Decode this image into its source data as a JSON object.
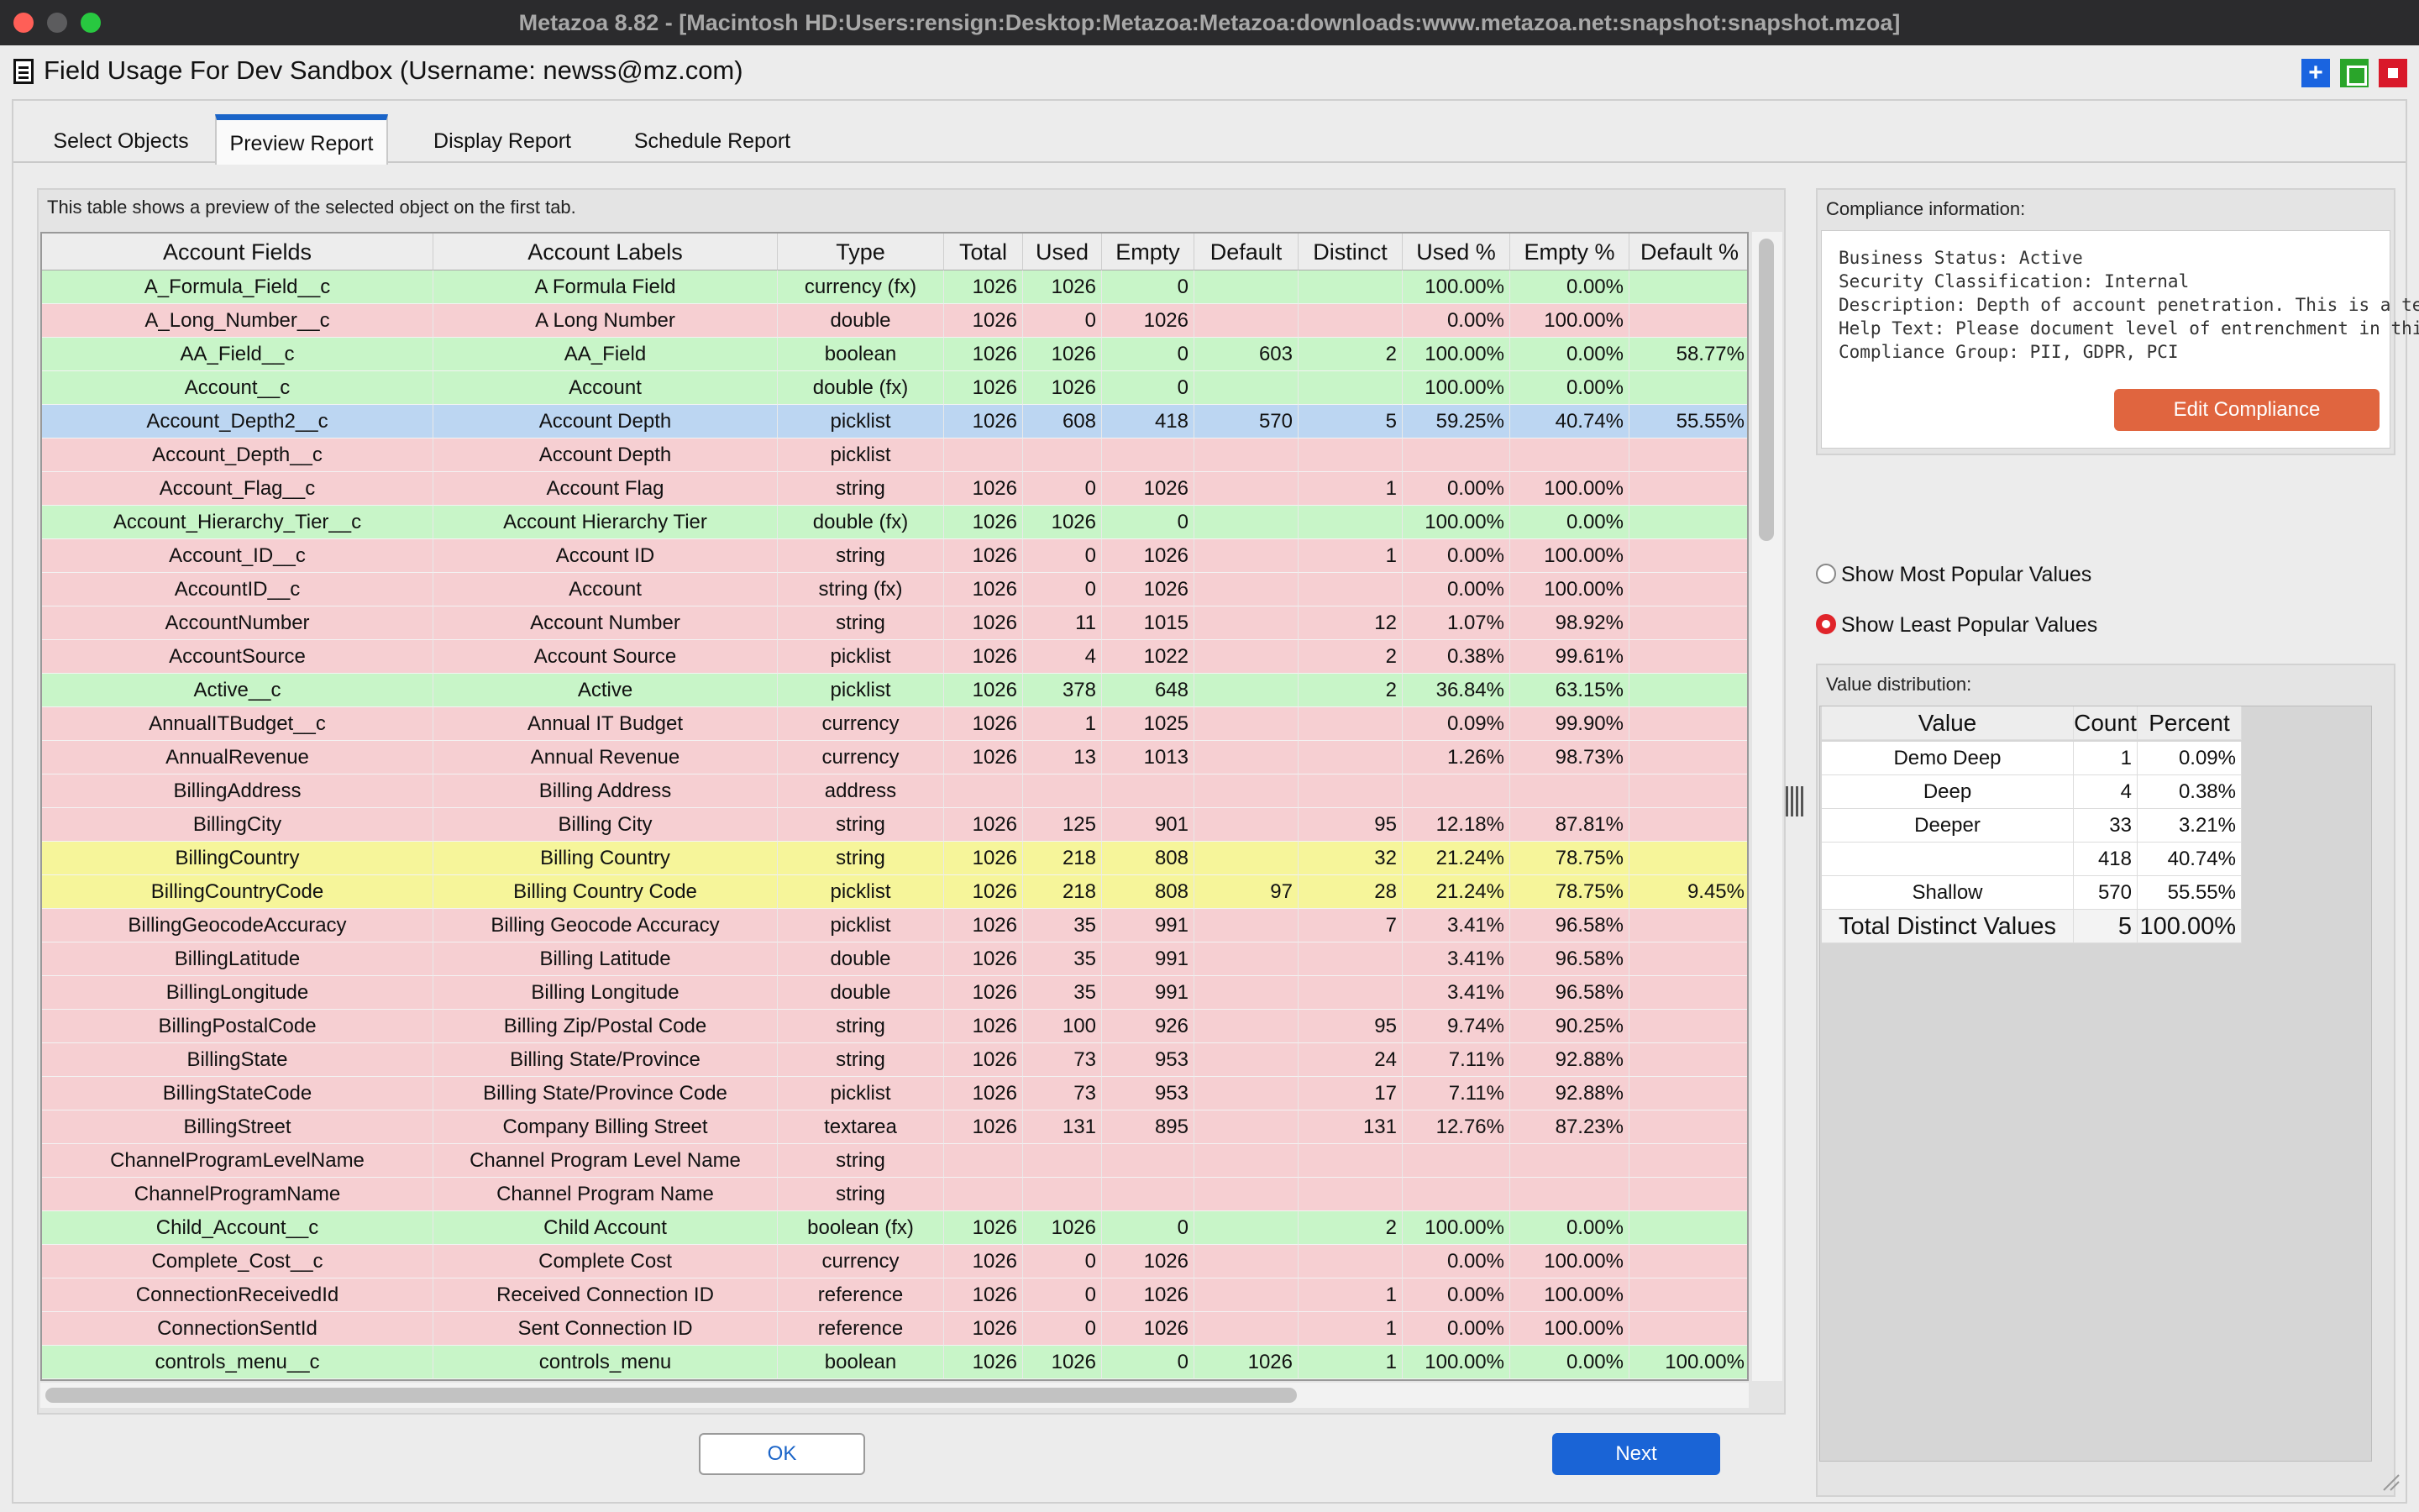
{
  "window": {
    "title": "Metazoa 8.82 - [Macintosh HD:Users:rensign:Desktop:Metazoa:Metazoa:downloads:www.metazoa.net:snapshot:snapshot.mzoa]"
  },
  "app": {
    "title": "Field Usage For Dev Sandbox (Username: newss@mz.com)"
  },
  "tabs": [
    {
      "label": "Select Objects"
    },
    {
      "label": "Preview Report",
      "active": true
    },
    {
      "label": "Display Report"
    },
    {
      "label": "Schedule Report"
    }
  ],
  "preview": {
    "caption": "This table shows a preview of the selected object on the first tab.",
    "columns": [
      "Account Fields",
      "Account Labels",
      "Type",
      "Total",
      "Used",
      "Empty",
      "Default",
      "Distinct",
      "Used %",
      "Empty %",
      "Default %"
    ],
    "rows": [
      {
        "s": "green",
        "v": [
          "A_Formula_Field__c",
          "A Formula Field",
          "currency (fx)",
          "1026",
          "1026",
          "0",
          "",
          "",
          "100.00%",
          "0.00%",
          ""
        ]
      },
      {
        "s": "red",
        "v": [
          "A_Long_Number__c",
          "A Long Number",
          "double",
          "1026",
          "0",
          "1026",
          "",
          "",
          "0.00%",
          "100.00%",
          ""
        ]
      },
      {
        "s": "green",
        "v": [
          "AA_Field__c",
          "AA_Field",
          "boolean",
          "1026",
          "1026",
          "0",
          "603",
          "2",
          "100.00%",
          "0.00%",
          "58.77%"
        ]
      },
      {
        "s": "green",
        "v": [
          "Account__c",
          "Account",
          "double (fx)",
          "1026",
          "1026",
          "0",
          "",
          "",
          "100.00%",
          "0.00%",
          ""
        ]
      },
      {
        "s": "blue",
        "v": [
          "Account_Depth2__c",
          "Account Depth",
          "picklist",
          "1026",
          "608",
          "418",
          "570",
          "5",
          "59.25%",
          "40.74%",
          "55.55%"
        ]
      },
      {
        "s": "red",
        "v": [
          "Account_Depth__c",
          "Account Depth",
          "picklist",
          "",
          "",
          "",
          "",
          "",
          "",
          "",
          ""
        ]
      },
      {
        "s": "red",
        "v": [
          "Account_Flag__c",
          "Account Flag",
          "string",
          "1026",
          "0",
          "1026",
          "",
          "1",
          "0.00%",
          "100.00%",
          ""
        ]
      },
      {
        "s": "green",
        "v": [
          "Account_Hierarchy_Tier__c",
          "Account Hierarchy Tier",
          "double (fx)",
          "1026",
          "1026",
          "0",
          "",
          "",
          "100.00%",
          "0.00%",
          ""
        ]
      },
      {
        "s": "red",
        "v": [
          "Account_ID__c",
          "Account ID",
          "string",
          "1026",
          "0",
          "1026",
          "",
          "1",
          "0.00%",
          "100.00%",
          ""
        ]
      },
      {
        "s": "red",
        "v": [
          "AccountID__c",
          "Account",
          "string (fx)",
          "1026",
          "0",
          "1026",
          "",
          "",
          "0.00%",
          "100.00%",
          ""
        ]
      },
      {
        "s": "red",
        "v": [
          "AccountNumber",
          "Account Number",
          "string",
          "1026",
          "11",
          "1015",
          "",
          "12",
          "1.07%",
          "98.92%",
          ""
        ]
      },
      {
        "s": "red",
        "v": [
          "AccountSource",
          "Account Source",
          "picklist",
          "1026",
          "4",
          "1022",
          "",
          "2",
          "0.38%",
          "99.61%",
          ""
        ]
      },
      {
        "s": "green",
        "v": [
          "Active__c",
          "Active",
          "picklist",
          "1026",
          "378",
          "648",
          "",
          "2",
          "36.84%",
          "63.15%",
          ""
        ]
      },
      {
        "s": "red",
        "v": [
          "AnnualITBudget__c",
          "Annual IT Budget",
          "currency",
          "1026",
          "1",
          "1025",
          "",
          "",
          "0.09%",
          "99.90%",
          ""
        ]
      },
      {
        "s": "red",
        "v": [
          "AnnualRevenue",
          "Annual Revenue",
          "currency",
          "1026",
          "13",
          "1013",
          "",
          "",
          "1.26%",
          "98.73%",
          ""
        ]
      },
      {
        "s": "red",
        "v": [
          "BillingAddress",
          "Billing Address",
          "address",
          "",
          "",
          "",
          "",
          "",
          "",
          "",
          ""
        ]
      },
      {
        "s": "red",
        "v": [
          "BillingCity",
          "Billing City",
          "string",
          "1026",
          "125",
          "901",
          "",
          "95",
          "12.18%",
          "87.81%",
          ""
        ]
      },
      {
        "s": "yellow",
        "v": [
          "BillingCountry",
          "Billing Country",
          "string",
          "1026",
          "218",
          "808",
          "",
          "32",
          "21.24%",
          "78.75%",
          ""
        ]
      },
      {
        "s": "yellow",
        "v": [
          "BillingCountryCode",
          "Billing Country Code",
          "picklist",
          "1026",
          "218",
          "808",
          "97",
          "28",
          "21.24%",
          "78.75%",
          "9.45%"
        ]
      },
      {
        "s": "red",
        "v": [
          "BillingGeocodeAccuracy",
          "Billing Geocode Accuracy",
          "picklist",
          "1026",
          "35",
          "991",
          "",
          "7",
          "3.41%",
          "96.58%",
          ""
        ]
      },
      {
        "s": "red",
        "v": [
          "BillingLatitude",
          "Billing Latitude",
          "double",
          "1026",
          "35",
          "991",
          "",
          "",
          "3.41%",
          "96.58%",
          ""
        ]
      },
      {
        "s": "red",
        "v": [
          "BillingLongitude",
          "Billing Longitude",
          "double",
          "1026",
          "35",
          "991",
          "",
          "",
          "3.41%",
          "96.58%",
          ""
        ]
      },
      {
        "s": "red",
        "v": [
          "BillingPostalCode",
          "Billing Zip/Postal Code",
          "string",
          "1026",
          "100",
          "926",
          "",
          "95",
          "9.74%",
          "90.25%",
          ""
        ]
      },
      {
        "s": "red",
        "v": [
          "BillingState",
          "Billing State/Province",
          "string",
          "1026",
          "73",
          "953",
          "",
          "24",
          "7.11%",
          "92.88%",
          ""
        ]
      },
      {
        "s": "red",
        "v": [
          "BillingStateCode",
          "Billing State/Province Code",
          "picklist",
          "1026",
          "73",
          "953",
          "",
          "17",
          "7.11%",
          "92.88%",
          ""
        ]
      },
      {
        "s": "red",
        "v": [
          "BillingStreet",
          "Company Billing Street",
          "textarea",
          "1026",
          "131",
          "895",
          "",
          "131",
          "12.76%",
          "87.23%",
          ""
        ]
      },
      {
        "s": "red",
        "v": [
          "ChannelProgramLevelName",
          "Channel Program Level Name",
          "string",
          "",
          "",
          "",
          "",
          "",
          "",
          "",
          ""
        ]
      },
      {
        "s": "red",
        "v": [
          "ChannelProgramName",
          "Channel Program Name",
          "string",
          "",
          "",
          "",
          "",
          "",
          "",
          "",
          ""
        ]
      },
      {
        "s": "green",
        "v": [
          "Child_Account__c",
          "Child Account",
          "boolean (fx)",
          "1026",
          "1026",
          "0",
          "",
          "2",
          "100.00%",
          "0.00%",
          ""
        ]
      },
      {
        "s": "red",
        "v": [
          "Complete_Cost__c",
          "Complete Cost",
          "currency",
          "1026",
          "0",
          "1026",
          "",
          "",
          "0.00%",
          "100.00%",
          ""
        ]
      },
      {
        "s": "red",
        "v": [
          "ConnectionReceivedId",
          "Received Connection ID",
          "reference",
          "1026",
          "0",
          "1026",
          "",
          "1",
          "0.00%",
          "100.00%",
          ""
        ]
      },
      {
        "s": "red",
        "v": [
          "ConnectionSentId",
          "Sent Connection ID",
          "reference",
          "1026",
          "0",
          "1026",
          "",
          "1",
          "0.00%",
          "100.00%",
          ""
        ]
      },
      {
        "s": "green",
        "v": [
          "controls_menu__c",
          "controls_menu",
          "boolean",
          "1026",
          "1026",
          "0",
          "1026",
          "1",
          "100.00%",
          "0.00%",
          "100.00%"
        ]
      }
    ]
  },
  "compliance": {
    "caption": "Compliance information:",
    "lines": [
      "Business Status: Active",
      "Security Classification: Internal",
      "Description: Depth of account penetration. This is a test",
      "Help Text: Please document level of entrenchment in this",
      "Compliance Group: PII, GDPR, PCI"
    ],
    "edit_label": "Edit Compliance"
  },
  "options": {
    "most_popular": "Show Most Popular Values",
    "least_popular": "Show Least Popular Values",
    "selected": "least_popular"
  },
  "distribution": {
    "caption": "Value distribution:",
    "columns": [
      "Value",
      "Count",
      "Percent"
    ],
    "rows": [
      [
        "Demo Deep",
        "1",
        "0.09%"
      ],
      [
        "Deep",
        "4",
        "0.38%"
      ],
      [
        "Deeper",
        "33",
        "3.21%"
      ],
      [
        "",
        "418",
        "40.74%"
      ],
      [
        "Shallow",
        "570",
        "55.55%"
      ]
    ],
    "total": [
      "Total Distinct Values",
      "5",
      "100.00%"
    ]
  },
  "buttons": {
    "ok": "OK",
    "next": "Next"
  },
  "colors": {
    "green": "#c8f5c8",
    "red": "#f6cfd2",
    "yellow": "#f6f59a",
    "blue": "#bcd6f2",
    "accent": "#1a64d6",
    "edit": "#e0653f"
  },
  "icons": {
    "window_add": "plus-icon",
    "window_max": "square-icon",
    "window_close": "stop-icon",
    "doc": "document-icon"
  }
}
